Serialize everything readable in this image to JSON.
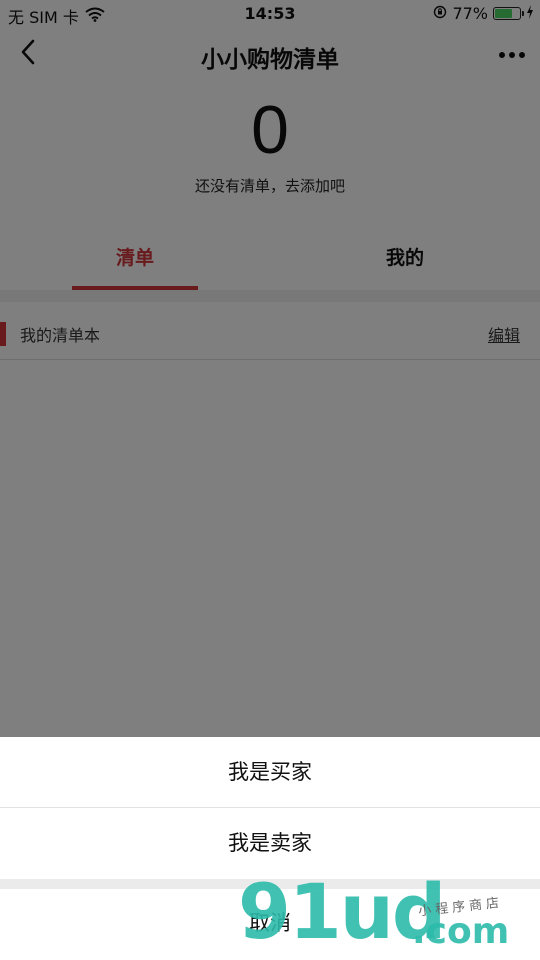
{
  "status_bar": {
    "carrier": "无 SIM 卡",
    "time": "14:53",
    "battery_percent": "77%",
    "battery_level": 0.77,
    "icons": [
      "wifi-icon",
      "orientation-lock-icon",
      "battery-icon",
      "charging-icon"
    ]
  },
  "nav": {
    "title": "小小购物清单",
    "back_icon": "chevron-left-icon",
    "more_icon": "more-dots-icon"
  },
  "summary": {
    "count": "0",
    "hint": "还没有清单，去添加吧"
  },
  "tabs": [
    {
      "label": "清单",
      "active": true
    },
    {
      "label": "我的",
      "active": false
    }
  ],
  "section": {
    "title": "我的清单本",
    "edit_label": "编辑"
  },
  "action_sheet": {
    "options": [
      {
        "label": "我是买家"
      },
      {
        "label": "我是卖家"
      }
    ],
    "cancel_label": "取消"
  },
  "watermark": {
    "logo": "91ud",
    "suffix": ".com",
    "tagline": "小程序商店"
  },
  "colors": {
    "accent": "#d0343a",
    "battery": "#4cd964",
    "overlay": "rgba(0,0,0,0.5)",
    "watermark": "#2bbaaa"
  }
}
